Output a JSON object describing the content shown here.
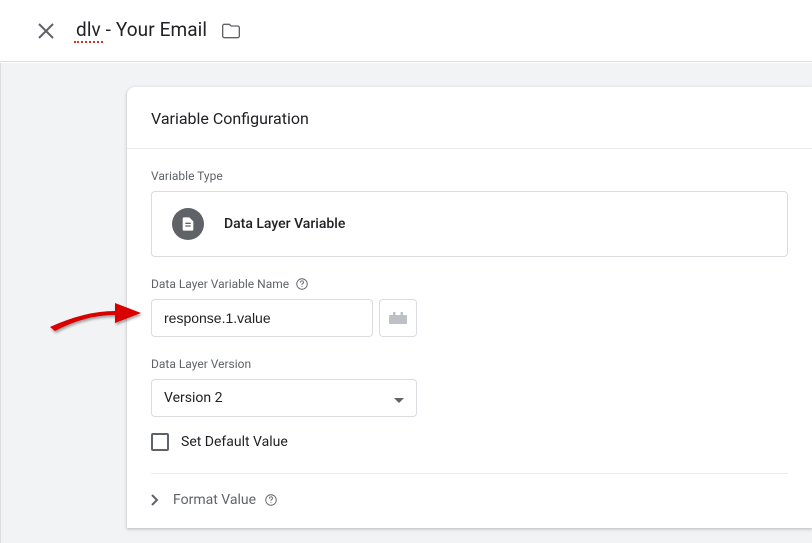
{
  "header": {
    "title_prefix": "dlv",
    "title_suffix": " - Your Email"
  },
  "panel": {
    "heading": "Variable Configuration",
    "variable_type_label": "Variable Type",
    "variable_type_value": "Data Layer Variable",
    "name_label": "Data Layer Variable Name",
    "name_value": "response.1.value",
    "version_label": "Data Layer Version",
    "version_value": "Version 2",
    "default_label": "Set Default Value",
    "format_label": "Format Value"
  }
}
